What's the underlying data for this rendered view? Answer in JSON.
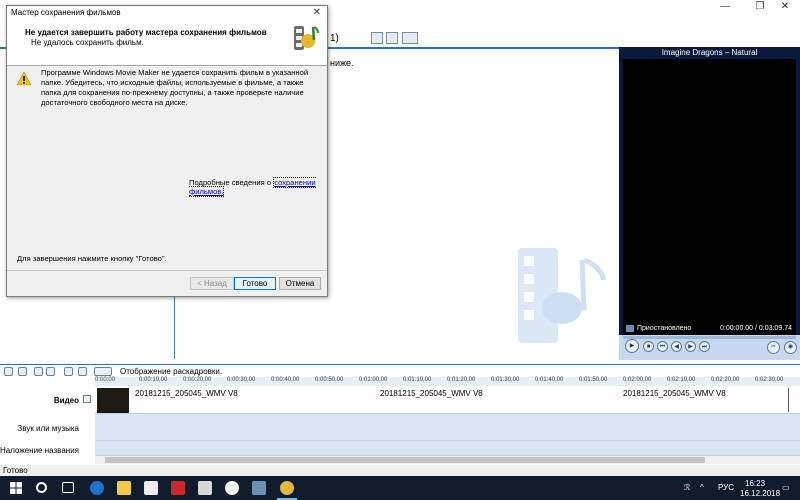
{
  "dialog": {
    "title": "Мастер сохранения фильмов",
    "heading": "Не удается завершить работу мастера сохранения фильмов",
    "subheading": "Не удалось сохранить фильм.",
    "message": "Программе Windows Movie Maker не удается сохранить фильм в указанной папке. Убедитесь, что исходные файлы, используемые в фильме, а также папка для сохранения по-прежнему доступны, а также проверьте наличие достаточного свободного места на диске.",
    "details_prefix": "Подробные сведения о",
    "details_link": "сохранении фильмов.",
    "finish_hint": "Для завершения нажмите кнопку \"Готово\".",
    "back_label": "< Назад",
    "finish_label": "Готово",
    "cancel_label": "Отмена",
    "close_glyph": "✕"
  },
  "window": {
    "minimize_glyph": "—",
    "maximize_glyph": "❐",
    "close_glyph": "✕",
    "toolbar_fragment": "1)",
    "collection_fragment": "ниже."
  },
  "preview": {
    "title": "Imagine Dragons – Natural",
    "status": "Приостановлено",
    "time": "0:00:00.00 / 0:03:09.74"
  },
  "timeline": {
    "view_label": "Отображение раскадровки.",
    "ruler_ticks": [
      "0:00:00",
      "0:00:10,00",
      "0:00:20,00",
      "0:00:30,00",
      "0:00:40,00",
      "0:00:50,00",
      "0:01:00,00",
      "0:01:10,00",
      "0:01:20,00",
      "0:01:30,00",
      "0:01:40,00",
      "0:01:50,00",
      "0:02:00,00",
      "0:02:10,00",
      "0:02:20,00",
      "0:02:30,00"
    ],
    "tracks": {
      "video": "Видео",
      "audio": "Звук или музыка",
      "title_overlay": "Наложение названия"
    },
    "clips": [
      "20181215_205045_WMV V8",
      "20181215_205045_WMV V8",
      "20181215_205045_WMV V8"
    ]
  },
  "statusbar": {
    "text": "Готово"
  },
  "taskbar": {
    "language": "РУС",
    "time": "16:23",
    "date": "16.12.2018"
  },
  "colors": {
    "accent": "#2e6bc6",
    "taskbar": "#101c2c",
    "link": "#0000cc"
  }
}
